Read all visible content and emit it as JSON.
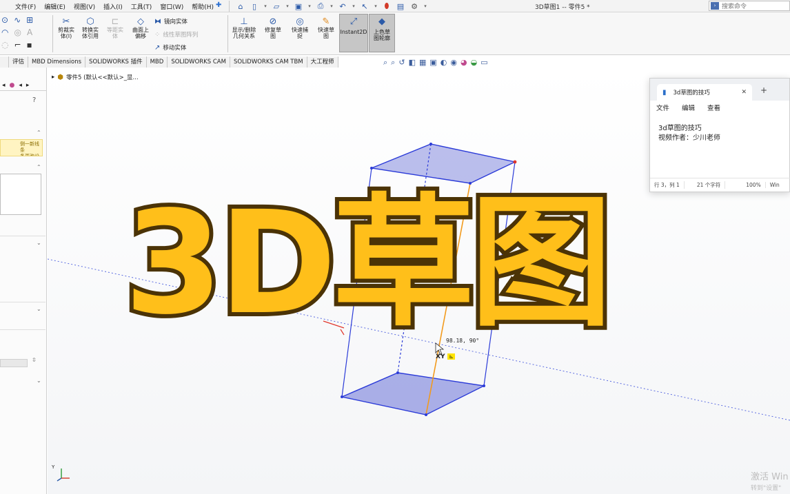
{
  "menubar": {
    "items": [
      "文件(F)",
      "编辑(E)",
      "视图(V)",
      "插入(I)",
      "工具(T)",
      "窗口(W)",
      "帮助(H)"
    ],
    "document_title": "3D草图1 -- 零件5 *",
    "search_placeholder": "搜索命令"
  },
  "ribbon": {
    "trim": "剪裁实\n体(I)",
    "convert": "转换实\n体引用",
    "offset": "等距实\n体",
    "surface_offset": "曲面上\n偏移",
    "mirror": "镜向实体",
    "linear_pattern": "线性草图阵列",
    "move": "移动实体",
    "relations": "显示/删除\n几何关系",
    "repair": "修复草\n图",
    "quick_snaps": "快速捕\n捉",
    "rapid_sketch": "快速草\n图",
    "instant2d": "Instant2D",
    "shaded": "上色草\n图轮廓"
  },
  "tabs": [
    "评估",
    "MBD Dimensions",
    "SOLIDWORKS 插件",
    "MBD",
    "SOLIDWORKS CAM",
    "SOLIDWORKS CAM TBM",
    "大工程师"
  ],
  "tree": {
    "part_label": "零件5 (默认<<默认>_显..."
  },
  "left_panel": {
    "warning": "侧一新线条\n条更改设定。"
  },
  "viewport": {
    "readout": "98.18, 90°",
    "xy_label": "XY",
    "triad_label": "Y",
    "watermark_line1": "激活 Win",
    "watermark_line2": "转到\"设置\""
  },
  "overlay_title": "3D草图",
  "notepad": {
    "tab_title": "3d草图的技巧",
    "menu": [
      "文件",
      "编辑",
      "查看"
    ],
    "line1": "3d草图的技巧",
    "line2": "视频作者：少川老师",
    "status_pos": "行 3，列 1",
    "status_chars": "21 个字符",
    "status_zoom": "100%",
    "status_os": "Win"
  },
  "colors": {
    "title_fill": "#ffbf1a",
    "title_stroke": "#4b3306",
    "face_fill": "#6a72d8",
    "edge": "#2b3bd8",
    "accent_orange": "#f29a1c"
  }
}
